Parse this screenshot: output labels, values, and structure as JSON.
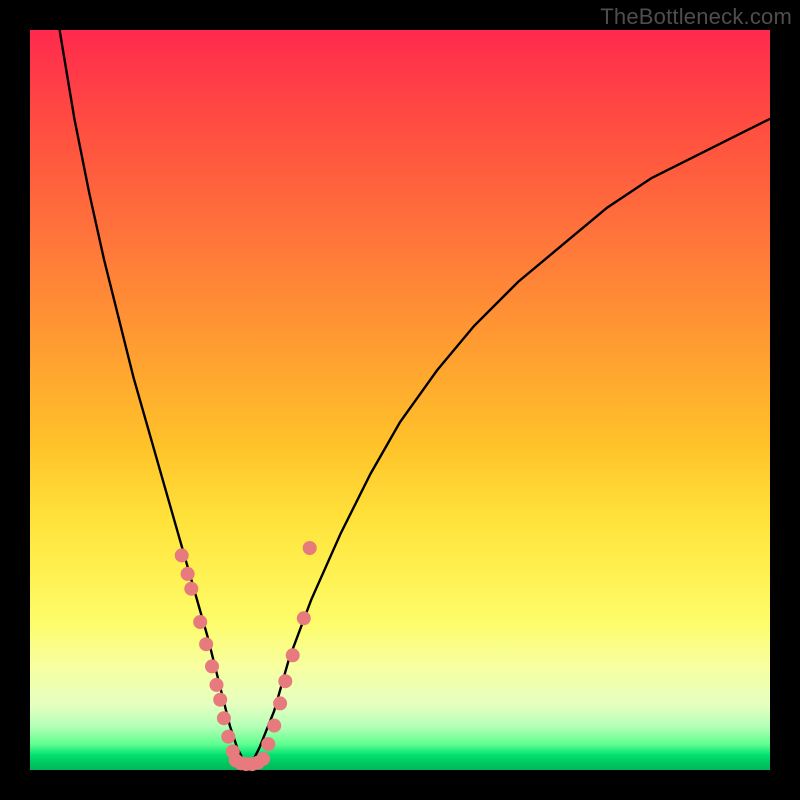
{
  "watermark": "TheBottleneck.com",
  "colors": {
    "frame": "#000000",
    "curve": "#000000",
    "points": "#e77a7c",
    "gradient_top": "#ff2a4d",
    "gradient_mid": "#ffe23a",
    "gradient_bottom": "#00c860"
  },
  "chart_data": {
    "type": "line",
    "title": "",
    "xlabel": "",
    "ylabel": "",
    "xlim": [
      0,
      100
    ],
    "ylim": [
      0,
      100
    ],
    "grid": false,
    "legend": false,
    "curve": {
      "comment": "V-shaped bottleneck curve. x is normalized horizontal position (0–100), y is percent of plot height from top (0=top, 100=bottom). Values estimated from pixel positions.",
      "x": [
        4,
        6,
        8,
        10,
        12,
        14,
        16,
        18,
        20,
        22,
        24,
        25,
        26,
        27,
        28,
        29,
        30,
        31,
        33,
        35,
        38,
        42,
        46,
        50,
        55,
        60,
        66,
        72,
        78,
        84,
        90,
        96,
        100
      ],
      "y": [
        0,
        12,
        22,
        31,
        39,
        47,
        54,
        61,
        68,
        75,
        82,
        86,
        90,
        94,
        97,
        99,
        99,
        97,
        92,
        85,
        77,
        68,
        60,
        53,
        46,
        40,
        34,
        29,
        24,
        20,
        17,
        14,
        12
      ]
    },
    "series": [
      {
        "name": "left-branch-points",
        "comment": "Pink point markers on the left descending branch (normalized 0–100).",
        "x": [
          20.5,
          21.3,
          21.8,
          23.0,
          23.8,
          24.6,
          25.2,
          25.7,
          26.2,
          26.8,
          27.4
        ],
        "y": [
          71.0,
          73.5,
          75.5,
          80.0,
          83.0,
          86.0,
          88.5,
          90.5,
          93.0,
          95.5,
          97.5
        ]
      },
      {
        "name": "trough-points",
        "comment": "Pink point markers along the flat bottom of the V.",
        "x": [
          27.8,
          28.5,
          29.2,
          30.0,
          30.8,
          31.5
        ],
        "y": [
          98.7,
          99.1,
          99.2,
          99.2,
          99.0,
          98.5
        ]
      },
      {
        "name": "right-branch-points",
        "comment": "Pink point markers on the right ascending branch.",
        "x": [
          32.2,
          33.0,
          33.8,
          34.5,
          35.5,
          37.0
        ],
        "y": [
          96.5,
          94.0,
          91.0,
          88.0,
          84.5,
          79.5
        ]
      },
      {
        "name": "upper-right-isolated-point",
        "x": [
          37.8
        ],
        "y": [
          70.0
        ]
      }
    ]
  }
}
